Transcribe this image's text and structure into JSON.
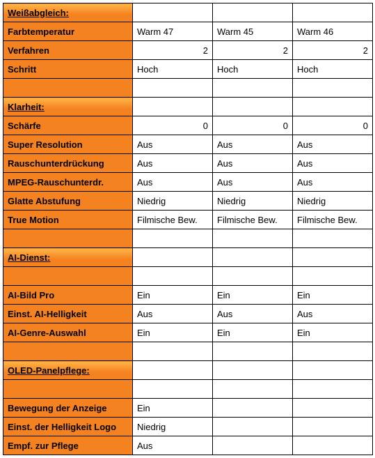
{
  "sections": {
    "weissabgleich": "Weißabgleich:",
    "klarheit": "Klarheit:",
    "aidienst": "AI-Dienst:",
    "oled": "OLED-Panelpflege:"
  },
  "rows": {
    "farbtemperatur": {
      "label": "Farbtemperatur",
      "v1": "Warm 47",
      "v2": "Warm 45",
      "v3": "Warm 46"
    },
    "verfahren": {
      "label": "Verfahren",
      "v1": "2",
      "v2": "2",
      "v3": "2"
    },
    "schritt": {
      "label": "Schritt",
      "v1": "Hoch",
      "v2": "Hoch",
      "v3": "Hoch"
    },
    "schaerfe": {
      "label": "Schärfe",
      "v1": "0",
      "v2": "0",
      "v3": "0"
    },
    "superres": {
      "label": "Super Resolution",
      "v1": "Aus",
      "v2": "Aus",
      "v3": "Aus"
    },
    "rausch": {
      "label": "Rauschunterdrückung",
      "v1": "Aus",
      "v2": "Aus",
      "v3": "Aus"
    },
    "mpeg": {
      "label": "MPEG-Rauschunterdr.",
      "v1": "Aus",
      "v2": "Aus",
      "v3": "Aus"
    },
    "glatte": {
      "label": "Glatte Abstufung",
      "v1": "Niedrig",
      "v2": "Niedrig",
      "v3": "Niedrig"
    },
    "truemotion": {
      "label": "True Motion",
      "v1": "Filmische Bew.",
      "v2": "Filmische Bew.",
      "v3": "Filmische Bew."
    },
    "aibildpro": {
      "label": "AI-Bild Pro",
      "v1": "Ein",
      "v2": "Ein",
      "v3": "Ein"
    },
    "aihell": {
      "label": "Einst. AI-Helligkeit",
      "v1": "Aus",
      "v2": "Aus",
      "v3": "Aus"
    },
    "aigenre": {
      "label": "AI-Genre-Auswahl",
      "v1": "Ein",
      "v2": "Ein",
      "v3": "Ein"
    },
    "bewegung": {
      "label": "Bewegung der Anzeige",
      "v1": "Ein",
      "v2": "",
      "v3": ""
    },
    "helllogo": {
      "label": "Einst. der Helligkeit Logo",
      "v1": "Niedrig",
      "v2": "",
      "v3": ""
    },
    "empf": {
      "label": "Empf. zur Pflege",
      "v1": "Aus",
      "v2": "",
      "v3": ""
    }
  }
}
